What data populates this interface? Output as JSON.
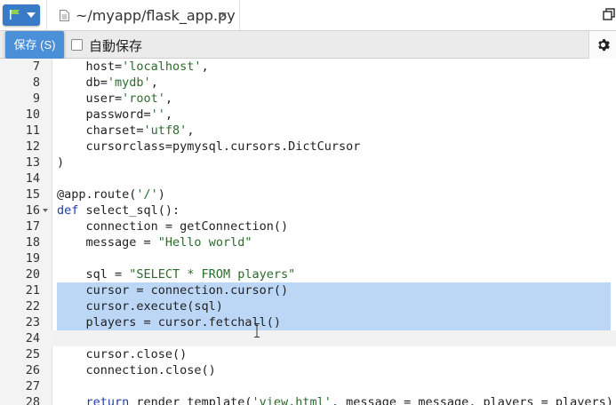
{
  "tab": {
    "title": "~/myapp/flask_app.py",
    "close": "×"
  },
  "toolbar": {
    "save_label": "保存 (S)",
    "autosave_label": "自動保存"
  },
  "editor": {
    "language": "python",
    "lines": [
      {
        "num": "7",
        "text": "    host='localhost',"
      },
      {
        "num": "8",
        "text": "    db='mydb',"
      },
      {
        "num": "9",
        "text": "    user='root',"
      },
      {
        "num": "10",
        "text": "    password='',"
      },
      {
        "num": "11",
        "text": "    charset='utf8',"
      },
      {
        "num": "12",
        "text": "    cursorclass=pymysql.cursors.DictCursor"
      },
      {
        "num": "13",
        "text": ")"
      },
      {
        "num": "14",
        "text": ""
      },
      {
        "num": "15",
        "text": "@app.route('/')"
      },
      {
        "num": "16",
        "text": "def select_sql():"
      },
      {
        "num": "17",
        "text": "    connection = getConnection()"
      },
      {
        "num": "18",
        "text": "    message = \"Hello world\""
      },
      {
        "num": "19",
        "text": ""
      },
      {
        "num": "20",
        "text": "    sql = \"SELECT * FROM players\""
      },
      {
        "num": "21",
        "text": "    cursor = connection.cursor()"
      },
      {
        "num": "22",
        "text": "    cursor.execute(sql)"
      },
      {
        "num": "23",
        "text": "    players = cursor.fetchall()"
      },
      {
        "num": "24",
        "text": ""
      },
      {
        "num": "25",
        "text": "    cursor.close()"
      },
      {
        "num": "26",
        "text": "    connection.close()"
      },
      {
        "num": "27",
        "text": ""
      },
      {
        "num": "28",
        "text": "    return render_template('view.html', message = message, players = players)"
      }
    ],
    "selected_lines": [
      "21",
      "22",
      "23"
    ],
    "active_line": "24"
  },
  "colors": {
    "accent": "#4a90d9",
    "selection": "#bcd6f6",
    "string": "#2b6b2b",
    "keyword": "#1f3fa8"
  }
}
